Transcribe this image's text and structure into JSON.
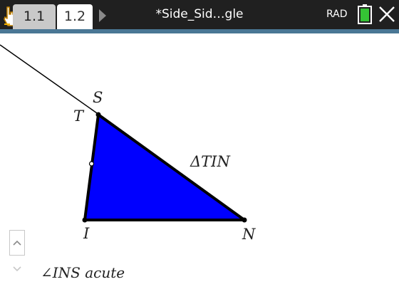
{
  "toolbar": {
    "tabs": [
      {
        "label": "1.1",
        "active": false
      },
      {
        "label": "1.2",
        "active": true
      }
    ],
    "document_title": "*Side_Sid…gle",
    "angle_mode": "RAD",
    "icons": {
      "pointer": "hand-pointer-icon",
      "next_page": "triangle-right-icon",
      "battery": "battery-icon",
      "close": "close-icon"
    },
    "colors": {
      "bar": "#202020",
      "accent_line": "#4a7795",
      "battery_fill": "#35c335"
    }
  },
  "geometry": {
    "points": {
      "S": "S",
      "T": "T",
      "I": "I",
      "N": "N"
    },
    "triangle_label": "ΔTIN",
    "triangle_fill": "#0000ff",
    "measurement": "∠INS acute"
  },
  "scroll": {
    "up_icon": "chevron-up-icon",
    "down_icon": "chevron-down-icon"
  }
}
